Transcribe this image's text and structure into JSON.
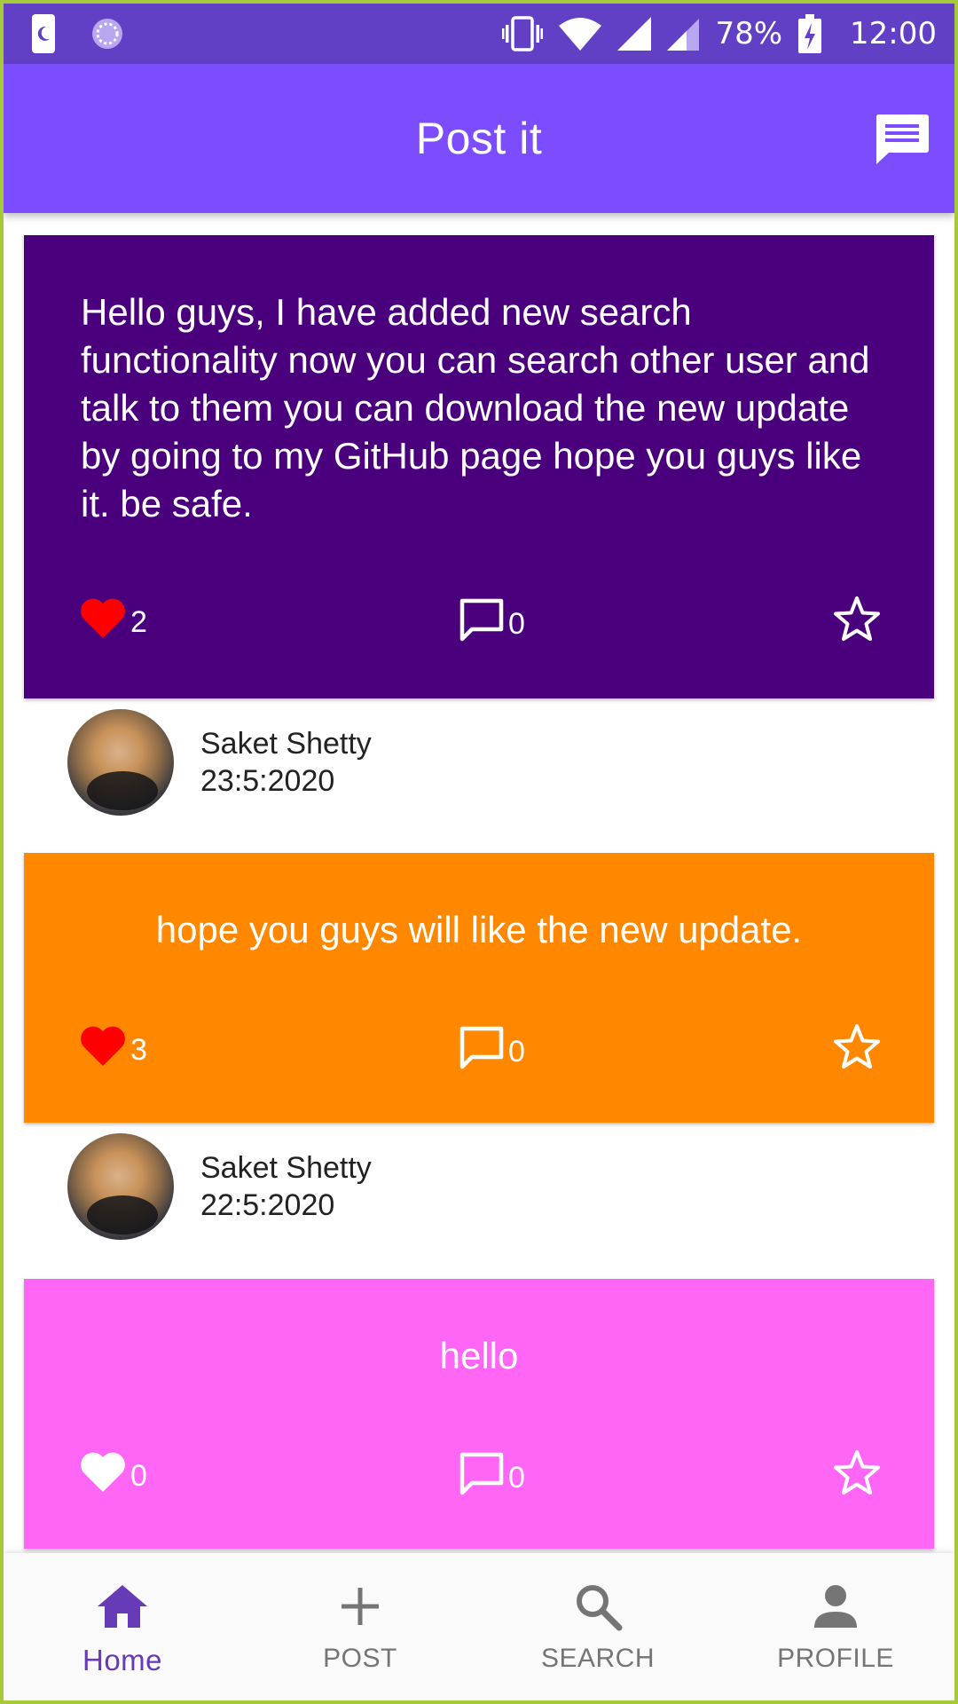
{
  "status_bar": {
    "battery": "78%",
    "time": "12:00",
    "icons": [
      "moon-icon",
      "loading-icon",
      "vibrate-icon",
      "wifi-icon",
      "signal-icon",
      "signal-icon-2",
      "battery-charging-icon"
    ]
  },
  "app_bar": {
    "title": "Post it",
    "action_icon": "message-icon"
  },
  "posts": [
    {
      "text": "Hello guys, I have added new search functionality now you can search other user and talk to them you can download the new update by going to my GitHub page hope you guys like it. be safe.",
      "color": "#4a007c",
      "likes": "2",
      "liked": true,
      "comments": "0",
      "author": "Saket Shetty",
      "date": "23:5:2020"
    },
    {
      "text": "hope you guys will like the new update.",
      "color": "#ff8800",
      "likes": "3",
      "liked": true,
      "comments": "0",
      "author": "Saket Shetty",
      "date": "22:5:2020"
    },
    {
      "text": "hello",
      "color": "#ff66f5",
      "likes": "0",
      "liked": false,
      "comments": "0"
    }
  ],
  "bottom_nav": {
    "items": [
      {
        "label": "Home",
        "icon": "home-icon",
        "active": true
      },
      {
        "label": "POST",
        "icon": "plus-icon",
        "active": false
      },
      {
        "label": "SEARCH",
        "icon": "search-icon",
        "active": false
      },
      {
        "label": "PROFILE",
        "icon": "person-icon",
        "active": false
      }
    ]
  },
  "colors": {
    "status_bar": "#6140c6",
    "app_bar": "#7c4dff",
    "liked_heart": "#ff0000",
    "nav_active": "#673ab7",
    "nav_inactive": "#757575"
  }
}
